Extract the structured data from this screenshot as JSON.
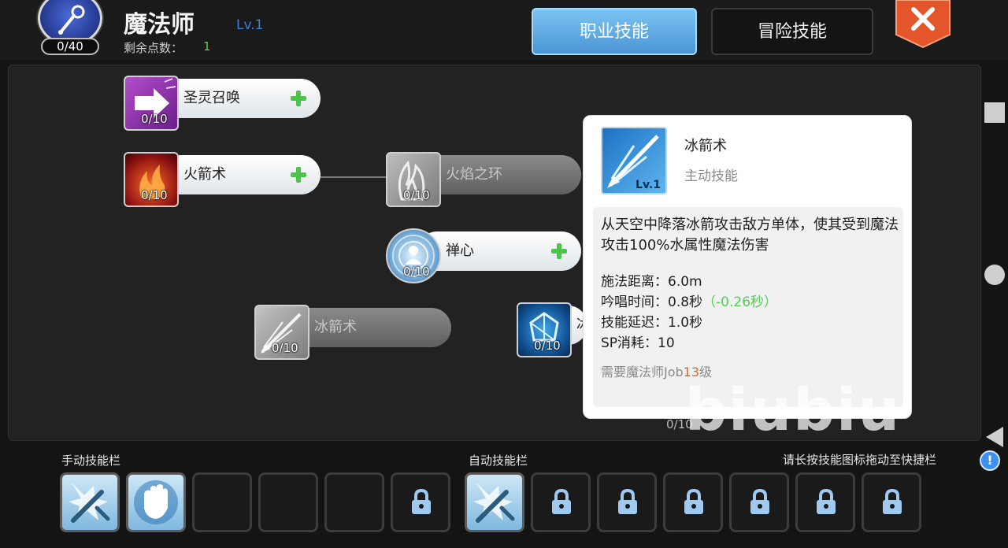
{
  "header": {
    "skill_points_counter": "0/40",
    "class_name": "魔法师",
    "class_level": "Lv.1",
    "remaining_points_label": "剩余点数：",
    "remaining_points": "1"
  },
  "tabs": {
    "job_skills": "职业技能",
    "adventure_skills": "冒险技能",
    "active_tab": "职业技能"
  },
  "skills": [
    {
      "name": "圣灵召唤",
      "count": "0/10",
      "state": "learnable",
      "icon": "holy-summon-icon"
    },
    {
      "name": "火箭术",
      "count": "0/10",
      "state": "learnable",
      "icon": "fire-bolt-icon"
    },
    {
      "name": "火焰之环",
      "count": "0/10",
      "state": "locked",
      "icon": "fire-ring-icon"
    },
    {
      "name": "禅心",
      "count": "0/10",
      "state": "learnable",
      "icon": "zen-mind-icon"
    },
    {
      "name": "冰箭术",
      "count": "0/10",
      "state": "locked",
      "icon": "cold-bolt-icon"
    },
    {
      "name": "冰",
      "count": "0/10",
      "state": "partially-hidden",
      "icon": "frost-diver-icon"
    }
  ],
  "tooltip": {
    "name": "冰箭术",
    "level": "Lv.1",
    "type": "主动技能",
    "description": "从天空中降落冰箭攻击敌方单体，使其受到魔法攻击100%水属性魔法伤害",
    "range": "施法距离：6.0m",
    "cast_time": "吟唱时间：0.8秒",
    "cast_time_bonus": "（-0.26秒）",
    "delay": "技能延迟：1.0秒",
    "sp_cost": "SP消耗：10",
    "requirement_prefix": "需要魔法师Job",
    "requirement_level": "13",
    "requirement_suffix": "级"
  },
  "watermark": "biubiu",
  "stray_count": "0/10",
  "bottom_bar": {
    "manual_label": "手动技能栏",
    "auto_label": "自动技能栏",
    "hint": "请长按技能图标拖动至快捷栏",
    "hint_icon": "!"
  },
  "colors": {
    "active_tab": "#5aa8e4",
    "close_button": "#e4552b",
    "green_plus": "#4cc44c",
    "bonus_green": "#4fd14f",
    "requirement_highlight": "#e0632b"
  }
}
